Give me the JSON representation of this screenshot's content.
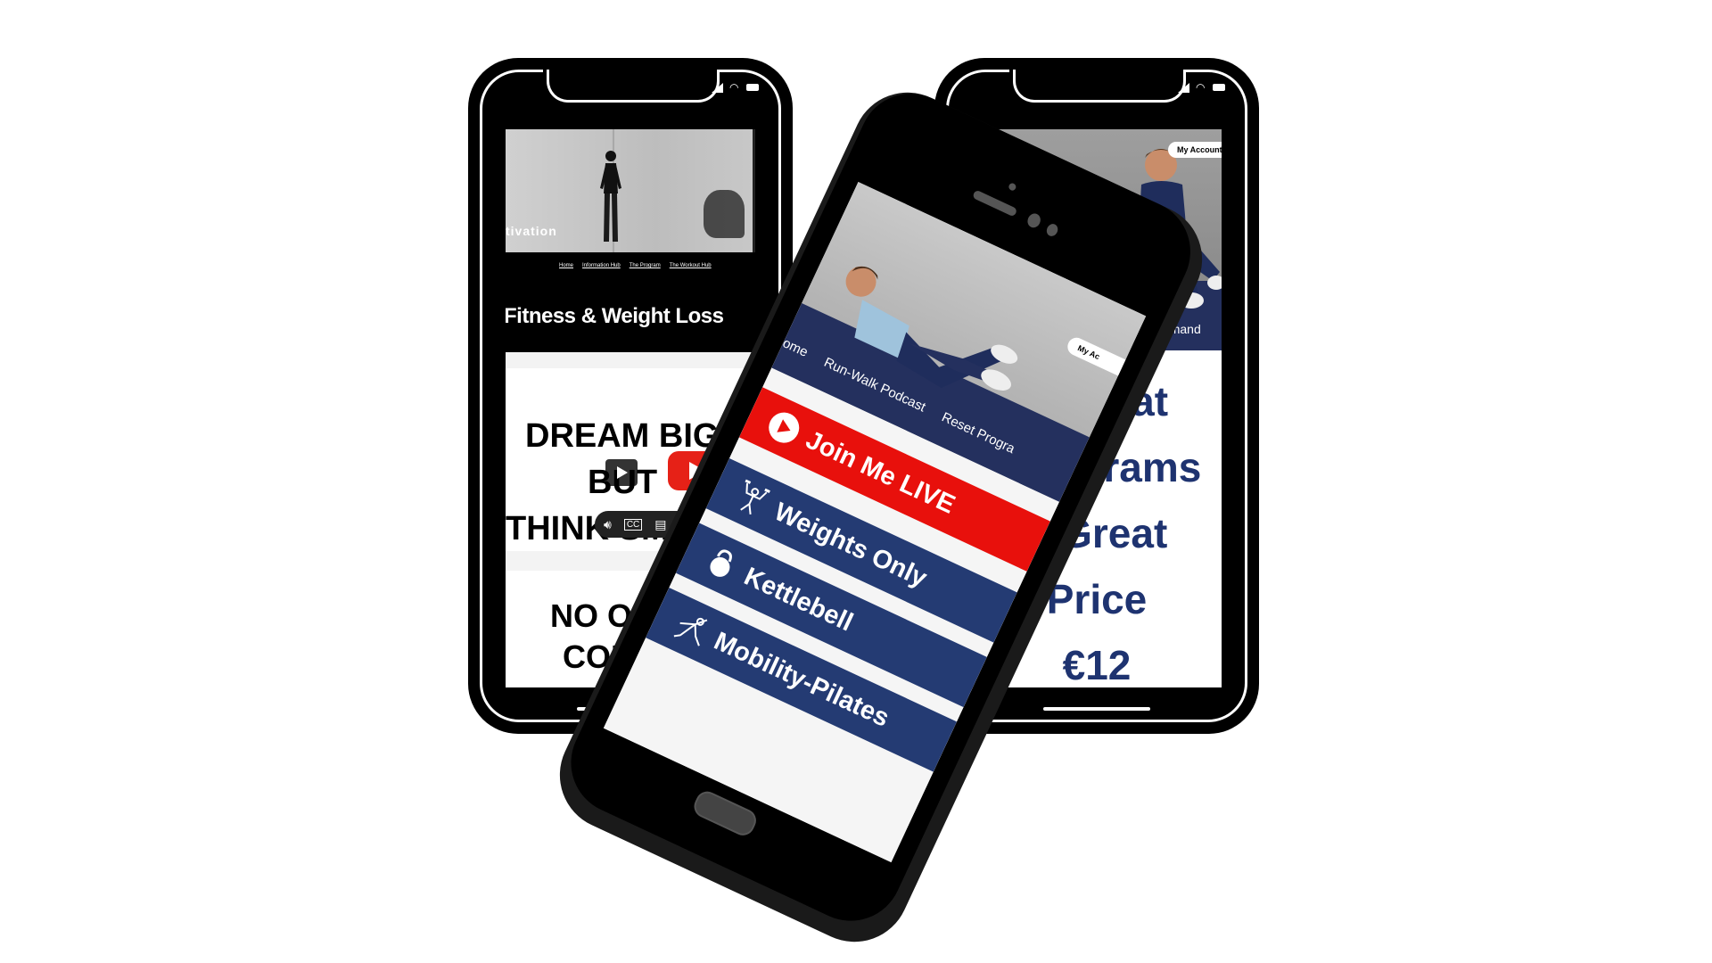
{
  "left_phone": {
    "hero_text": "tivation",
    "nav": [
      "Home",
      "Information Hub",
      "The Program",
      "The Workout Hub"
    ],
    "headline": "Fitness & Weight Loss",
    "card_lines": [
      "DREAM BIG",
      "BUT",
      "THINK SMALL"
    ],
    "card2_lines": [
      "NO ON",
      "COM"
    ]
  },
  "right_phone": {
    "account_label": "My Account",
    "nav_partial": "s",
    "nav_item": "Live & On-demand",
    "price_lines": [
      "Great",
      "Programs",
      "1 Great",
      "Price",
      "€12"
    ]
  },
  "middle_phone": {
    "account_label": "My Ac",
    "nav": [
      "ome",
      "Run-Walk Podcast",
      "Reset Progra"
    ],
    "buttons": [
      {
        "label": "Join Me LIVE",
        "icon": "play-circle-icon"
      },
      {
        "label": "Weights Only",
        "icon": "weightlifter-icon"
      },
      {
        "label": "Kettlebell",
        "icon": "kettlebell-icon"
      },
      {
        "label": "Mobility-Pilates",
        "icon": "stretch-figure-icon"
      }
    ]
  },
  "colors": {
    "navy": "#243b73",
    "price_text": "#1e3370",
    "live_red": "#e8100c",
    "youtube_red": "#e62117"
  }
}
